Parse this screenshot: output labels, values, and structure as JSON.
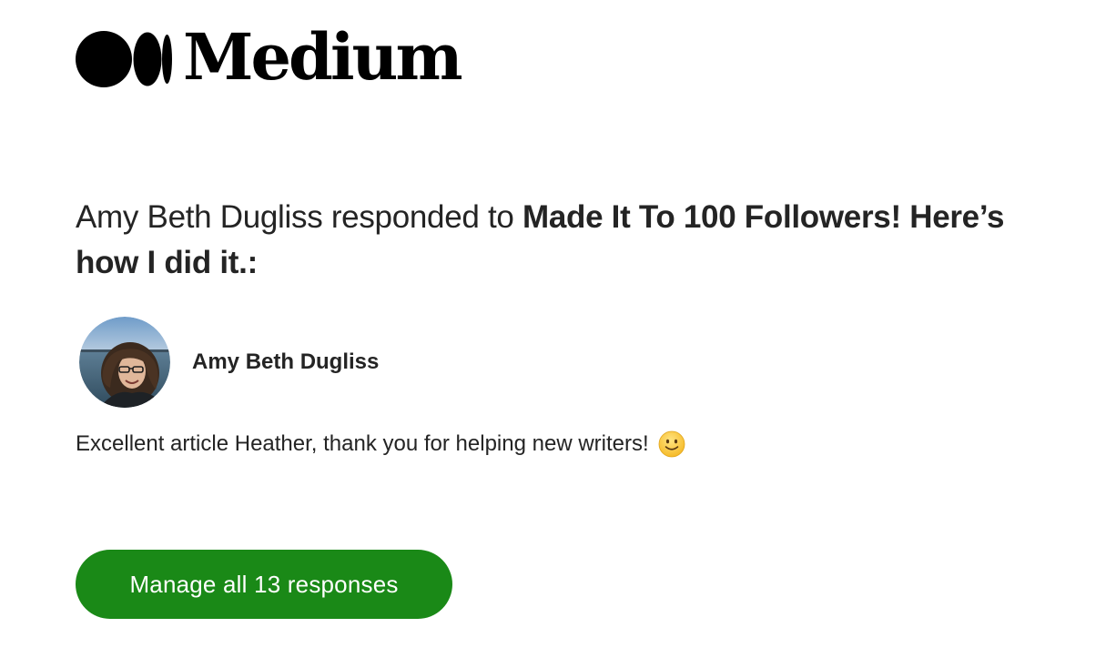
{
  "brand": {
    "name": "Medium",
    "logo_icon": "medium-logo-icon",
    "logo_color": "#000000"
  },
  "notification": {
    "actor": "Amy Beth Dugliss",
    "action_text": " responded to ",
    "article_title": "Made It To 100 Followers! Here’s how I did it.:"
  },
  "response": {
    "author_name": "Amy Beth Dugliss",
    "avatar_icon": "avatar-photo",
    "text": "Excellent article Heather, thank you for helping new writers!",
    "emoji_icon": "slightly-smiling-face-icon"
  },
  "cta": {
    "label": "Manage all 13 responses",
    "color": "#1a8917",
    "text_color": "#ffffff"
  }
}
